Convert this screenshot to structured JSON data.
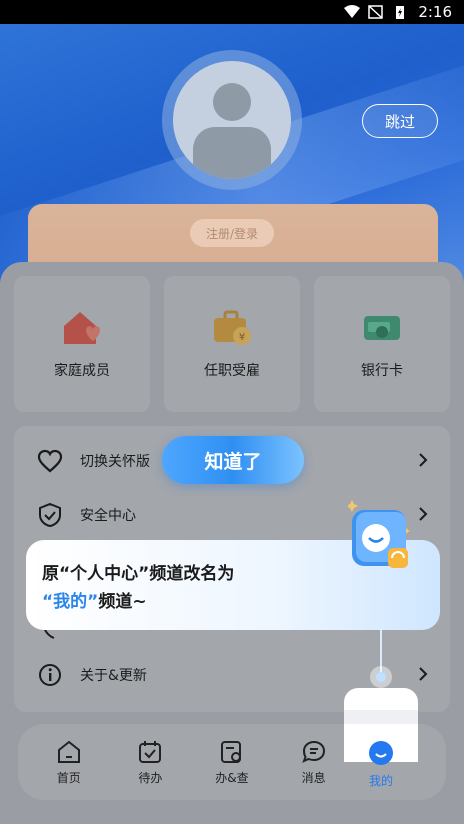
{
  "status_bar": {
    "time": "2:16"
  },
  "header": {
    "skip_label": "跳过",
    "login_label": "注册/登录"
  },
  "tiles": [
    {
      "label": "家庭成员",
      "icon": "family-home-icon"
    },
    {
      "label": "任职受雇",
      "icon": "briefcase-icon"
    },
    {
      "label": "银行卡",
      "icon": "bank-card-icon"
    }
  ],
  "list": [
    {
      "label": "切换关怀版",
      "icon": "heart-icon"
    },
    {
      "label": "安全中心",
      "icon": "shield-check-icon"
    },
    {
      "label": "",
      "icon": "phone-icon"
    },
    {
      "label": "关于&更新",
      "icon": "info-icon"
    }
  ],
  "tabs": [
    {
      "label": "首页",
      "icon": "home-icon"
    },
    {
      "label": "待办",
      "icon": "calendar-check-icon"
    },
    {
      "label": "办&查",
      "icon": "document-search-icon"
    },
    {
      "label": "消息",
      "icon": "message-icon"
    },
    {
      "label": "我的",
      "icon": "smile-icon",
      "active": true
    }
  ],
  "guide": {
    "confirm_label": "知道了",
    "line1": "原“个人中心”频道改名为",
    "line2_highlight": "“我的”",
    "line2_rest": "频道~"
  },
  "colors": {
    "accent": "#2479f0",
    "overlay_panel": "#a3a6ab"
  }
}
